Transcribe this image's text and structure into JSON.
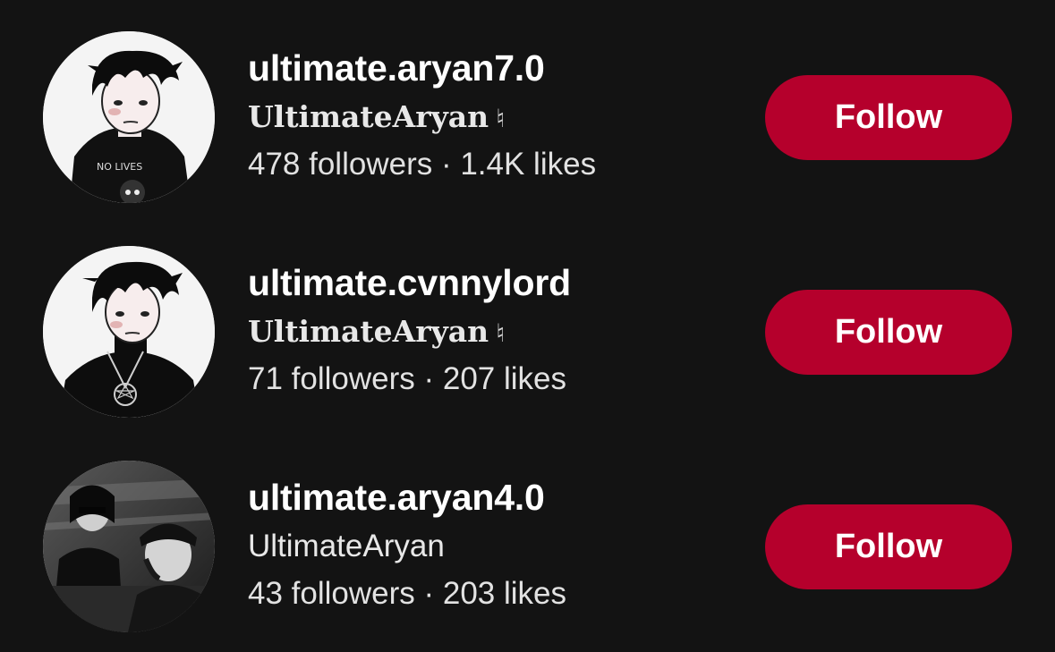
{
  "accounts": [
    {
      "username": "ultimate.aryan7.0",
      "display_name": "UltimateAryan",
      "badge": "♮",
      "stats": "478 followers · 1.4K likes",
      "follow_label": "Follow",
      "avatar_text": "NO LIVES"
    },
    {
      "username": "ultimate.cvnnylord",
      "display_name": "UltimateAryan",
      "badge": "♮",
      "stats": "71 followers · 207 likes",
      "follow_label": "Follow"
    },
    {
      "username": "ultimate.aryan4.0",
      "display_name": "UltimateAryan",
      "stats": "43 followers · 203 likes",
      "follow_label": "Follow"
    }
  ],
  "colors": {
    "background": "#131313",
    "follow_button": "#b5002c",
    "text_primary": "#ffffff",
    "text_secondary": "#e2e2e2"
  }
}
